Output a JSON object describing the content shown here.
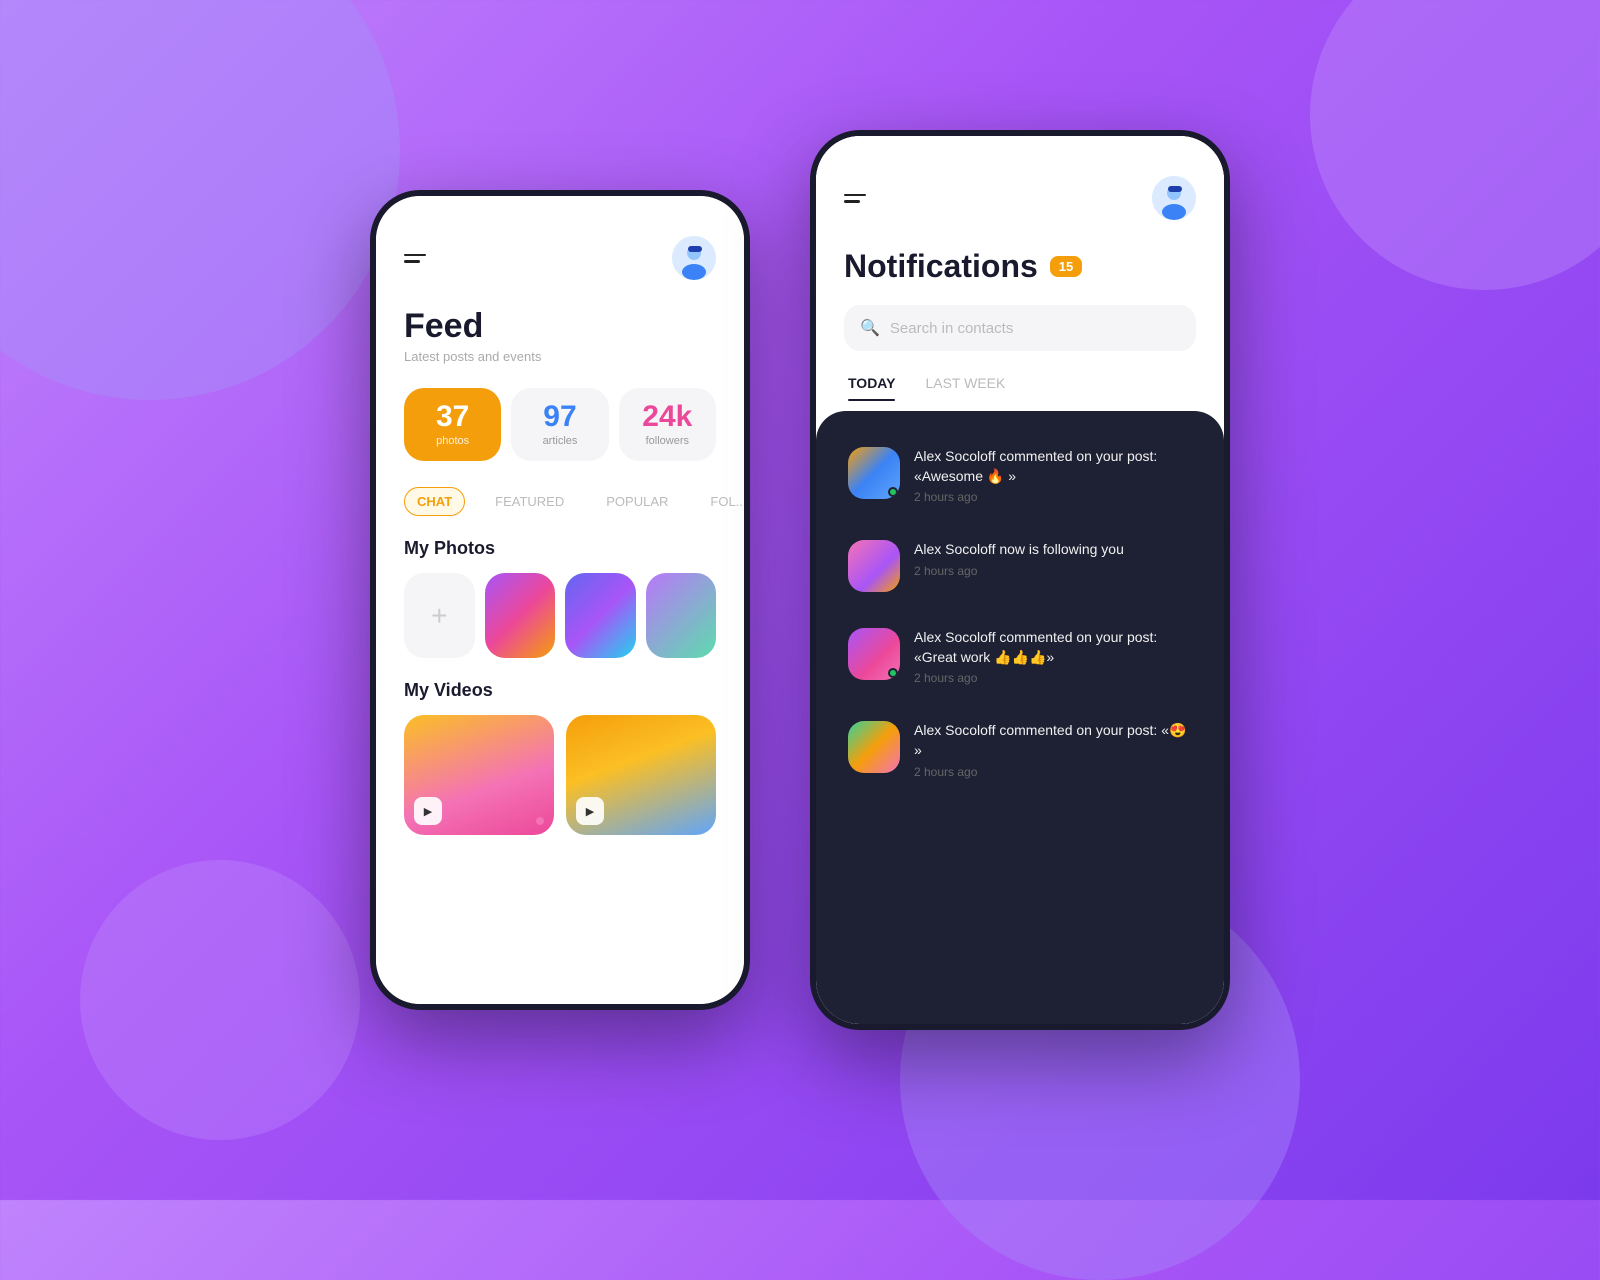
{
  "background": {
    "color_start": "#c084fc",
    "color_end": "#7c3aed"
  },
  "left_phone": {
    "header": {
      "menu_label": "menu",
      "avatar_label": "user-avatar"
    },
    "feed": {
      "title": "Feed",
      "subtitle": "Latest posts and events"
    },
    "stats": [
      {
        "number": "37",
        "label": "photos",
        "style": "highlight"
      },
      {
        "number": "97",
        "label": "articles",
        "style": "blue"
      },
      {
        "number": "24k",
        "label": "followers",
        "style": "pink"
      }
    ],
    "tabs": [
      {
        "label": "CHAT",
        "active": true
      },
      {
        "label": "FEATURED",
        "active": false
      },
      {
        "label": "POPULAR",
        "active": false
      },
      {
        "label": "FOL...",
        "active": false
      }
    ],
    "my_photos": {
      "title": "My Photos",
      "add_label": "+"
    },
    "my_videos": {
      "title": "My Videos"
    }
  },
  "right_phone": {
    "header": {
      "menu_label": "menu",
      "avatar_label": "user-avatar"
    },
    "notifications": {
      "title": "Notifications",
      "badge_count": "15"
    },
    "search": {
      "placeholder": "Search in contacts"
    },
    "tabs": [
      {
        "label": "TODAY",
        "active": true
      },
      {
        "label": "LAST WEEK",
        "active": false
      }
    ],
    "items": [
      {
        "avatar_style": "1",
        "has_online_dot": true,
        "text": "Alex Socoloff commented on your post: «Awesome 🔥 »",
        "time": "2 hours ago"
      },
      {
        "avatar_style": "2",
        "has_online_dot": false,
        "text": "Alex Socoloff now is following you",
        "time": "2 hours ago"
      },
      {
        "avatar_style": "3",
        "has_online_dot": true,
        "text": "Alex Socoloff commented on your post: «Great work 👍👍👍»",
        "time": "2 hours ago"
      },
      {
        "avatar_style": "4",
        "has_online_dot": false,
        "text": "Alex Socoloff commented on your post: «😍 »",
        "time": "2 hours ago"
      }
    ]
  }
}
